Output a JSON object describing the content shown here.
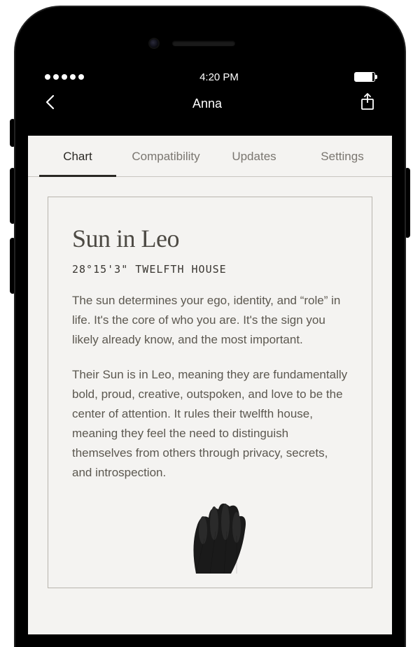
{
  "status_bar": {
    "time": "4:20 PM"
  },
  "nav": {
    "title": "Anna"
  },
  "tabs": [
    {
      "label": "Chart",
      "active": true
    },
    {
      "label": "Compatibility",
      "active": false
    },
    {
      "label": "Updates",
      "active": false
    },
    {
      "label": "Settings",
      "active": false
    }
  ],
  "card": {
    "title": "Sun in Leo",
    "coords": "28°15'3\" TWELFTH HOUSE",
    "paragraph1": "The sun determines your ego, identity, and “role” in life. It's the core of who you are. It's the sign you likely already know, and the most important.",
    "paragraph2": "Their Sun is in Leo, meaning they are fundamentally bold, proud, creative, outspoken, and love to be the center of attention.  It rules their twelfth house, meaning they feel the need to distinguish themselves from others through privacy, secrets, and introspection."
  }
}
